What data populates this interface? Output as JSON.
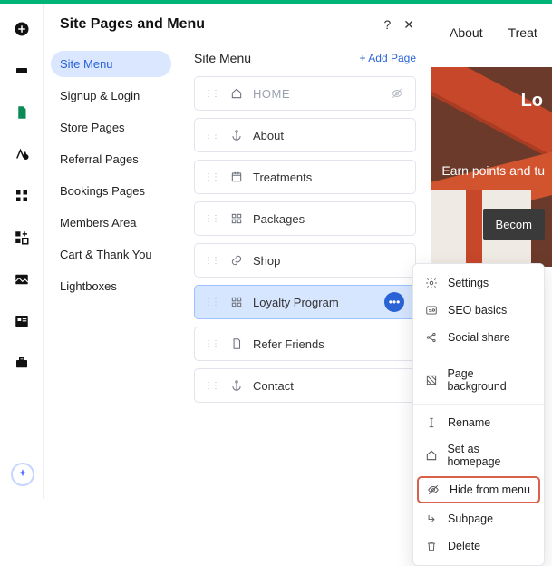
{
  "panel": {
    "title": "Site Pages and Menu",
    "help": "?",
    "close": "✕"
  },
  "sideList": {
    "items": [
      {
        "label": "Site Menu",
        "active": true
      },
      {
        "label": "Signup & Login"
      },
      {
        "label": "Store Pages"
      },
      {
        "label": "Referral Pages"
      },
      {
        "label": "Bookings Pages"
      },
      {
        "label": "Members Area"
      },
      {
        "label": "Cart & Thank You"
      },
      {
        "label": "Lightboxes"
      }
    ]
  },
  "content": {
    "title": "Site Menu",
    "addPage": "Add Page"
  },
  "pages": [
    {
      "label": "HOME",
      "icon": "home",
      "home": true
    },
    {
      "label": "About",
      "icon": "anchor"
    },
    {
      "label": "Treatments",
      "icon": "calendar"
    },
    {
      "label": "Packages",
      "icon": "packages"
    },
    {
      "label": "Shop",
      "icon": "link"
    },
    {
      "label": "Loyalty Program",
      "icon": "packages",
      "selected": true
    },
    {
      "label": "Refer Friends",
      "icon": "page"
    },
    {
      "label": "Contact",
      "icon": "anchor"
    }
  ],
  "previewNav": {
    "item1": "About",
    "item2": "Treat"
  },
  "hero": {
    "title": "Lo",
    "subtitle": "Earn points and tu",
    "cta": "Becom"
  },
  "contextMenu": {
    "items": [
      {
        "label": "Settings",
        "icon": "gear"
      },
      {
        "label": "SEO basics",
        "icon": "seo"
      },
      {
        "label": "Social share",
        "icon": "share"
      },
      {
        "sep": true
      },
      {
        "label": "Page background",
        "icon": "bg"
      },
      {
        "sep": true
      },
      {
        "label": "Rename",
        "icon": "rename"
      },
      {
        "label": "Set as homepage",
        "icon": "home"
      },
      {
        "label": "Hide from menu",
        "icon": "hide",
        "highlight": true
      },
      {
        "label": "Subpage",
        "icon": "sub"
      },
      {
        "label": "Delete",
        "icon": "trash"
      }
    ]
  }
}
